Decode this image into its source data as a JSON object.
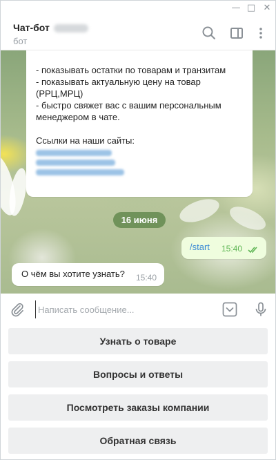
{
  "window": {
    "controls": {
      "minimize": "—",
      "maximize": "□",
      "close": "✕"
    }
  },
  "header": {
    "title": "Чат-бот",
    "subtitle": "бот",
    "icons": [
      "search-icon",
      "sidebar-toggle-icon",
      "more-vertical-icon"
    ]
  },
  "messages": {
    "first": {
      "lines": [
        "- показывать остатки по товарам и транзитам",
        "- показывать актуальную цену на товар",
        "(РРЦ,МРЦ)",
        "- быстро свяжет вас с вашим персональным",
        "менеджером в чате.",
        "",
        "Ссылки на наши сайты:"
      ]
    },
    "date": "16 июня",
    "outgoing": {
      "text": "/start",
      "time": "15:40"
    },
    "question": {
      "text": "О чём вы хотите узнать?",
      "time": "15:40"
    }
  },
  "input": {
    "placeholder": "Написать сообщение...",
    "icons": [
      "attach-icon",
      "bot-keyboard-icon",
      "microphone-icon"
    ]
  },
  "keyboard": {
    "buttons": [
      "Узнать о товаре",
      "Вопросы и ответы",
      "Посмотреть заказы компании",
      "Обратная связь"
    ]
  },
  "colors": {
    "accent": "#3a8ad6",
    "date_pill": "#5c8448",
    "outgoing_bubble": "#effdde",
    "read_check": "#5fb655"
  }
}
